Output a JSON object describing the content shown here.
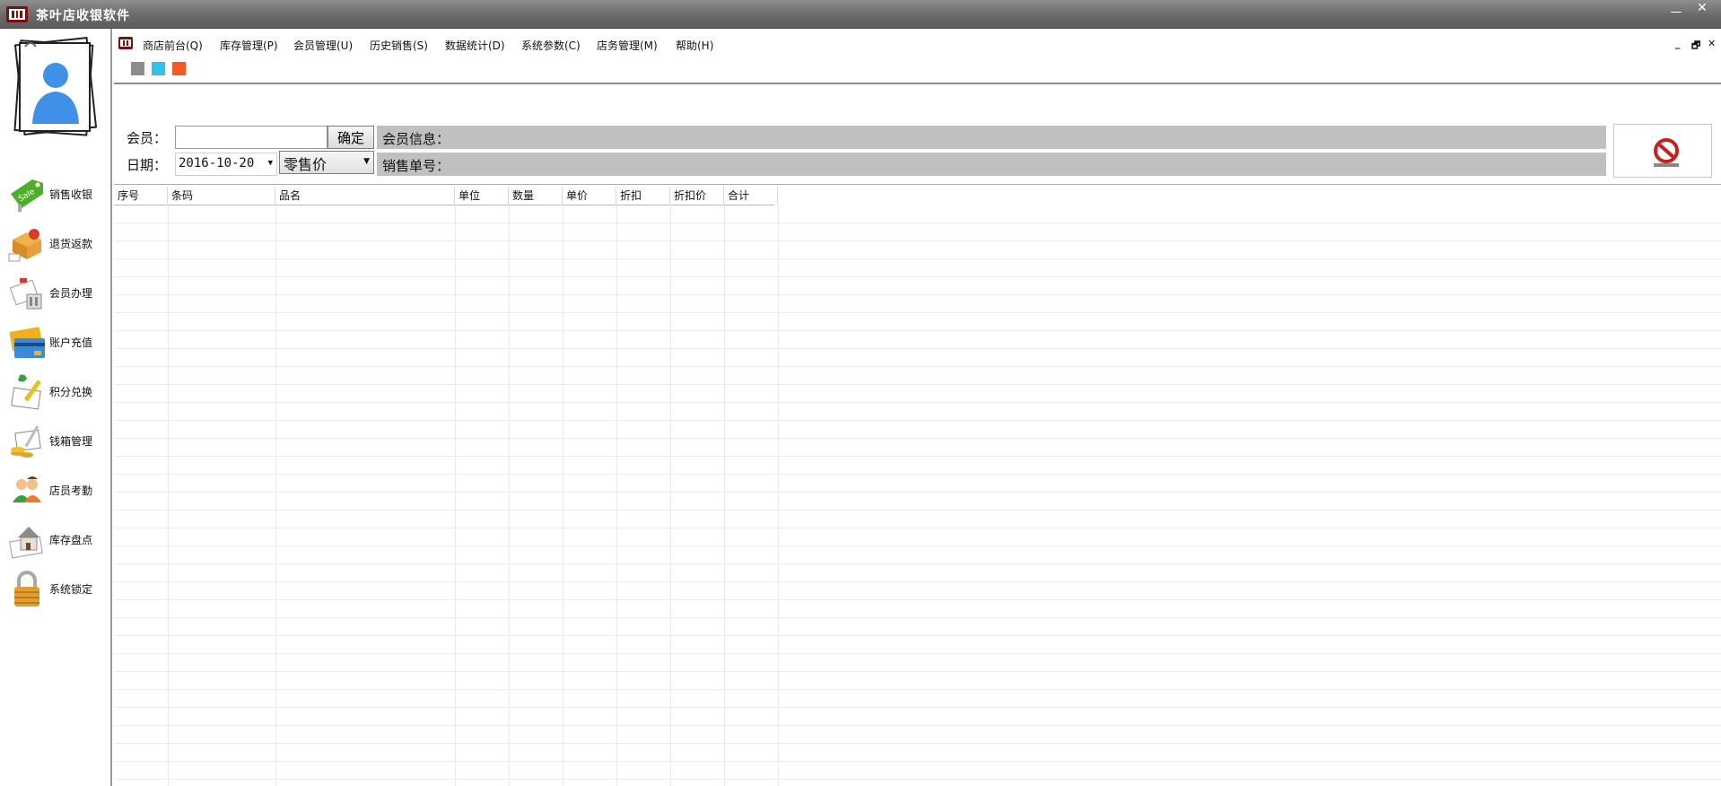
{
  "window": {
    "title": "茶叶店收银软件",
    "min_label": "",
    "close_label": "✕"
  },
  "sidebar": {
    "items": [
      {
        "label": "销售收银",
        "icon": "sale-tag-icon"
      },
      {
        "label": "退货返款",
        "icon": "return-box-icon"
      },
      {
        "label": "会员办理",
        "icon": "member-card-icon"
      },
      {
        "label": "账户充值",
        "icon": "credit-card-icon"
      },
      {
        "label": "积分兑换",
        "icon": "points-exchange-icon"
      },
      {
        "label": "钱箱管理",
        "icon": "cash-box-icon"
      },
      {
        "label": "店员考勤",
        "icon": "staff-icon"
      },
      {
        "label": "库存盘点",
        "icon": "inventory-house-icon"
      },
      {
        "label": "系统锁定",
        "icon": "padlock-icon"
      }
    ]
  },
  "menu": {
    "items": [
      "商店前台(Q)",
      "库存管理(P)",
      "会员管理(U)",
      "历史销售(S)",
      "数据统计(D)",
      "系统参数(C)",
      "店务管理(M)",
      "帮助(H)"
    ],
    "mdi_min": "_",
    "mdi_restore": "🗗",
    "mdi_close": "✕"
  },
  "theme_colors": [
    "#8c8c8c",
    "#33c0ec",
    "#f25a22"
  ],
  "form": {
    "member_label": "会员：",
    "member_value": "",
    "confirm_label": "确定",
    "date_label": "日期：",
    "date_value": "2016-10-20",
    "price_type": "零售价",
    "member_info_label": "会员信息：",
    "sale_no_label": "销售单号："
  },
  "grid": {
    "columns": [
      "序号",
      "条码",
      "品名",
      "单位",
      "数量",
      "单价",
      "折扣",
      "折扣价",
      "合计"
    ],
    "rows": []
  }
}
